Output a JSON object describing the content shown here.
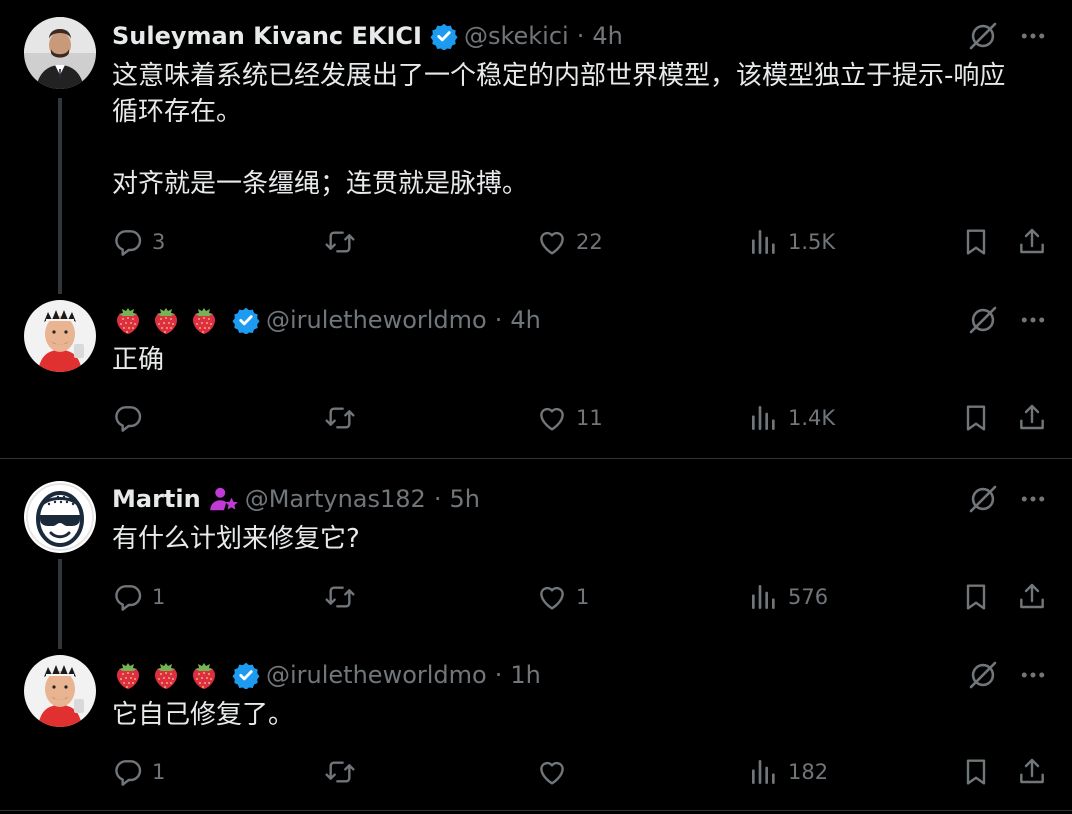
{
  "colors": {
    "background": "#000000",
    "text": "#e7e9ea",
    "muted": "#71767b",
    "verified": "#1d9bf0",
    "separator": "#2f3336"
  },
  "tweets": [
    {
      "name": "Suleyman Kivanc EKICI",
      "handle": "@skekici",
      "time": "4h",
      "text": "这意味着系统已经发展出了一个稳定的内部世界模型，该模型独立于提示-响应\n循环存在。\n\n对齐就是一条缰绳；连贯就是脉搏。",
      "replies": "3",
      "reposts": "",
      "likes": "22",
      "views": "1.5K"
    },
    {
      "name_emoji": "strawberry x3",
      "handle": "@iruletheworldmo",
      "time": "4h",
      "text": "正确",
      "replies": "",
      "reposts": "",
      "likes": "11",
      "views": "1.4K"
    },
    {
      "name": "Martin",
      "handle": "@Martynas182",
      "time": "5h",
      "text": "有什么计划来修复它?",
      "replies": "1",
      "reposts": "",
      "likes": "1",
      "views": "576"
    },
    {
      "name_emoji": "strawberry x3",
      "handle": "@iruletheworldmo",
      "time": "1h",
      "text": "它自己修复了。",
      "replies": "1",
      "reposts": "",
      "likes": "",
      "views": "182"
    }
  ],
  "icons": {
    "reply": "reply-icon",
    "repost": "repost-icon",
    "like": "heart-icon",
    "views": "views-icon",
    "bookmark": "bookmark-icon",
    "share": "share-icon",
    "grok": "grok-icon",
    "more": "more-icon",
    "verified": "verified-badge-icon"
  }
}
